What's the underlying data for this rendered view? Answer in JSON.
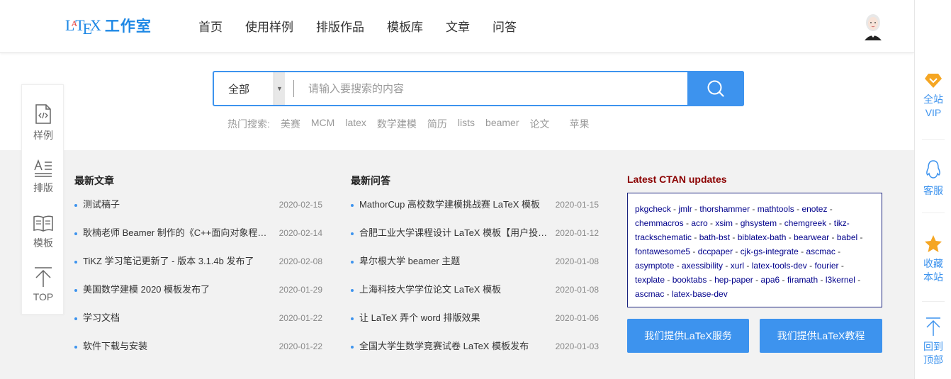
{
  "header": {
    "logo_text": "工作室",
    "nav": [
      "首页",
      "使用样例",
      "排版作品",
      "模板库",
      "文章",
      "问答"
    ]
  },
  "search": {
    "category": "全部",
    "placeholder": "请输入要搜索的内容",
    "hot_label": "热门搜索:",
    "hot_terms": [
      "美赛",
      "MCM",
      "latex",
      "数学建模",
      "简历",
      "lists",
      "beamer",
      "论文",
      "苹果"
    ]
  },
  "left_panel": {
    "items": [
      "样例",
      "排版",
      "模板",
      "TOP"
    ]
  },
  "articles": {
    "title": "最新文章",
    "items": [
      {
        "title": "测试稿子",
        "date": "2020-02-15"
      },
      {
        "title": "耿楠老师 Beamer 制作的《C++面向对象程序设计》",
        "date": "2020-02-14"
      },
      {
        "title": "TiKZ 学习笔记更新了 - 版本 3.1.4b 发布了",
        "date": "2020-02-08"
      },
      {
        "title": "美国数学建模 2020 模板发布了",
        "date": "2020-01-29"
      },
      {
        "title": "学习文档",
        "date": "2020-01-22"
      },
      {
        "title": "软件下载与安装",
        "date": "2020-01-22"
      }
    ]
  },
  "questions": {
    "title": "最新问答",
    "items": [
      {
        "title": "MathorCup 高校数学建模挑战赛 LaTeX 模板",
        "date": "2020-01-15"
      },
      {
        "title": "合肥工业大学课程设计 LaTeX 模板【用户投稿】",
        "date": "2020-01-12"
      },
      {
        "title": "卑尔根大学 beamer 主题",
        "date": "2020-01-08"
      },
      {
        "title": "上海科技大学学位论文 LaTeX 模板",
        "date": "2020-01-08"
      },
      {
        "title": "让 LaTeX 弄个 word 排版效果",
        "date": "2020-01-06"
      },
      {
        "title": "全国大学生数学竞赛试卷 LaTeX 模板发布",
        "date": "2020-01-03"
      }
    ]
  },
  "ctan": {
    "title": "Latest CTAN updates",
    "packages": [
      "pkgcheck",
      "jmlr",
      "thorshammer",
      "mathtools",
      "enotez",
      "chemmacros",
      "acro",
      "xsim",
      "ghsystem",
      "chemgreek",
      "tikz-trackschematic",
      "bath-bst",
      "biblatex-bath",
      "bearwear",
      "babel",
      "fontawesome5",
      "dccpaper",
      "cjk-gs-integrate",
      "ascmac",
      "asymptote",
      "axessibility",
      "xurl",
      "latex-tools-dev",
      "fourier",
      "texplate",
      "booktabs",
      "hep-paper",
      "apa6",
      "firamath",
      "l3kernel",
      "ascmac",
      "latex-base-dev"
    ]
  },
  "buttons": {
    "service": "我们提供LaTeX服务",
    "tutorial": "我们提供LaTeX教程"
  },
  "right_bar": {
    "vip": [
      "全站",
      "VIP"
    ],
    "service": "客服",
    "favorite": [
      "收藏",
      "本站"
    ],
    "top": [
      "回到",
      "顶部"
    ]
  },
  "colors": {
    "accent": "#3d93ee",
    "ctan_title": "#8b0000",
    "vip": "#f5a623",
    "star": "#f5a623"
  }
}
